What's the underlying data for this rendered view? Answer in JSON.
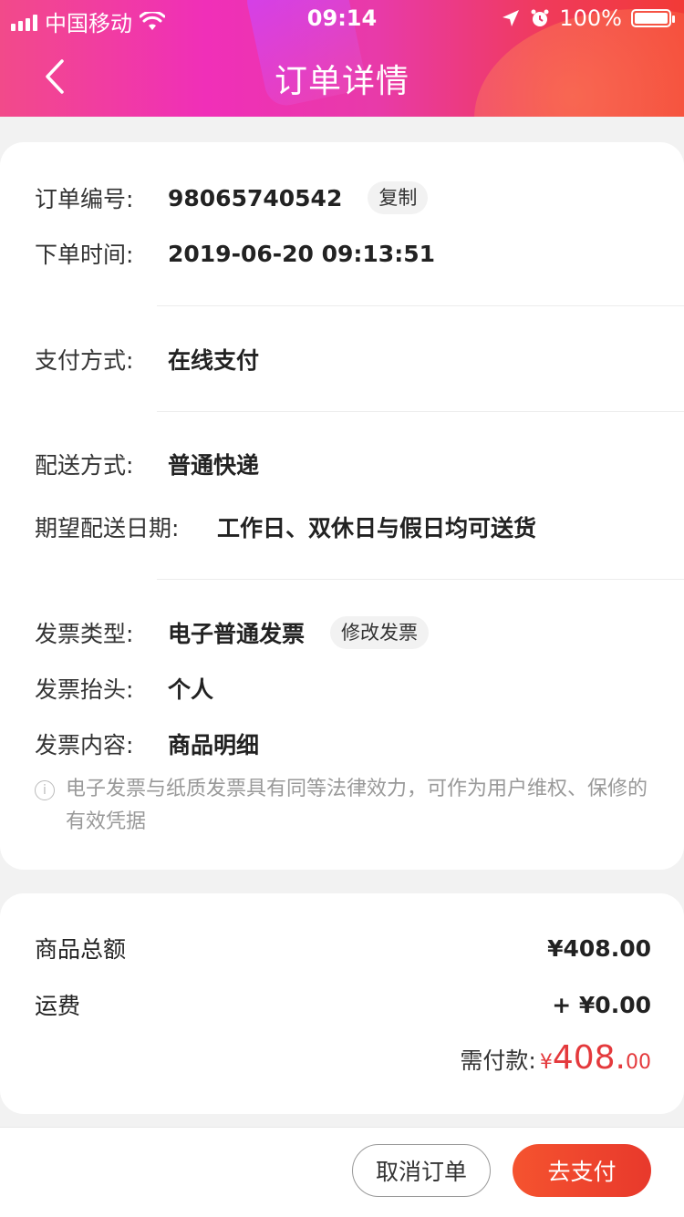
{
  "status_bar": {
    "carrier": "中国移动",
    "time": "09:14",
    "battery": "100%"
  },
  "header": {
    "title": "订单详情"
  },
  "order": {
    "number_label": "订单编号:",
    "number_value": "98065740542",
    "copy_label": "复制",
    "time_label": "下单时间:",
    "time_value": "2019-06-20 09:13:51"
  },
  "payment": {
    "label": "支付方式:",
    "value": "在线支付"
  },
  "delivery": {
    "method_label": "配送方式:",
    "method_value": "普通快递",
    "date_label": "期望配送日期:",
    "date_value": "工作日、双休日与假日均可送货"
  },
  "invoice": {
    "type_label": "发票类型:",
    "type_value": "电子普通发票",
    "modify_label": "修改发票",
    "title_label": "发票抬头:",
    "title_value": "个人",
    "content_label": "发票内容:",
    "content_value": "商品明细",
    "note": "电子发票与纸质发票具有同等法律效力，可作为用户维权、保修的有效凭据"
  },
  "price": {
    "goods_label": "商品总额",
    "goods_value": "¥408.00",
    "shipping_label": "运费",
    "shipping_value": "+ ¥0.00",
    "due_label": "需付款:",
    "due_currency": "¥",
    "due_integer": "408.",
    "due_decimal": "00"
  },
  "actions": {
    "cancel_label": "取消订单",
    "pay_label": "去支付"
  },
  "colors": {
    "accent": "#e4393c"
  }
}
